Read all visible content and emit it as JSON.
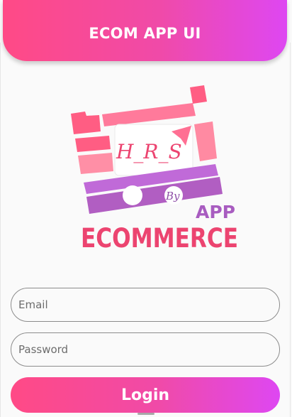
{
  "header": {
    "title": "ECOM APP UI"
  },
  "logo": {
    "initials": "H_R_S",
    "by": "By",
    "app": "APP",
    "brand": "ECOMMERCE"
  },
  "form": {
    "email_placeholder": "Email",
    "password_placeholder": "Password",
    "login_label": "Login"
  },
  "colors": {
    "gradient_start": "#ff4a86",
    "gradient_end": "#de47f2",
    "brand_pink": "#ec4470",
    "brand_purple": "#a85cc0"
  }
}
